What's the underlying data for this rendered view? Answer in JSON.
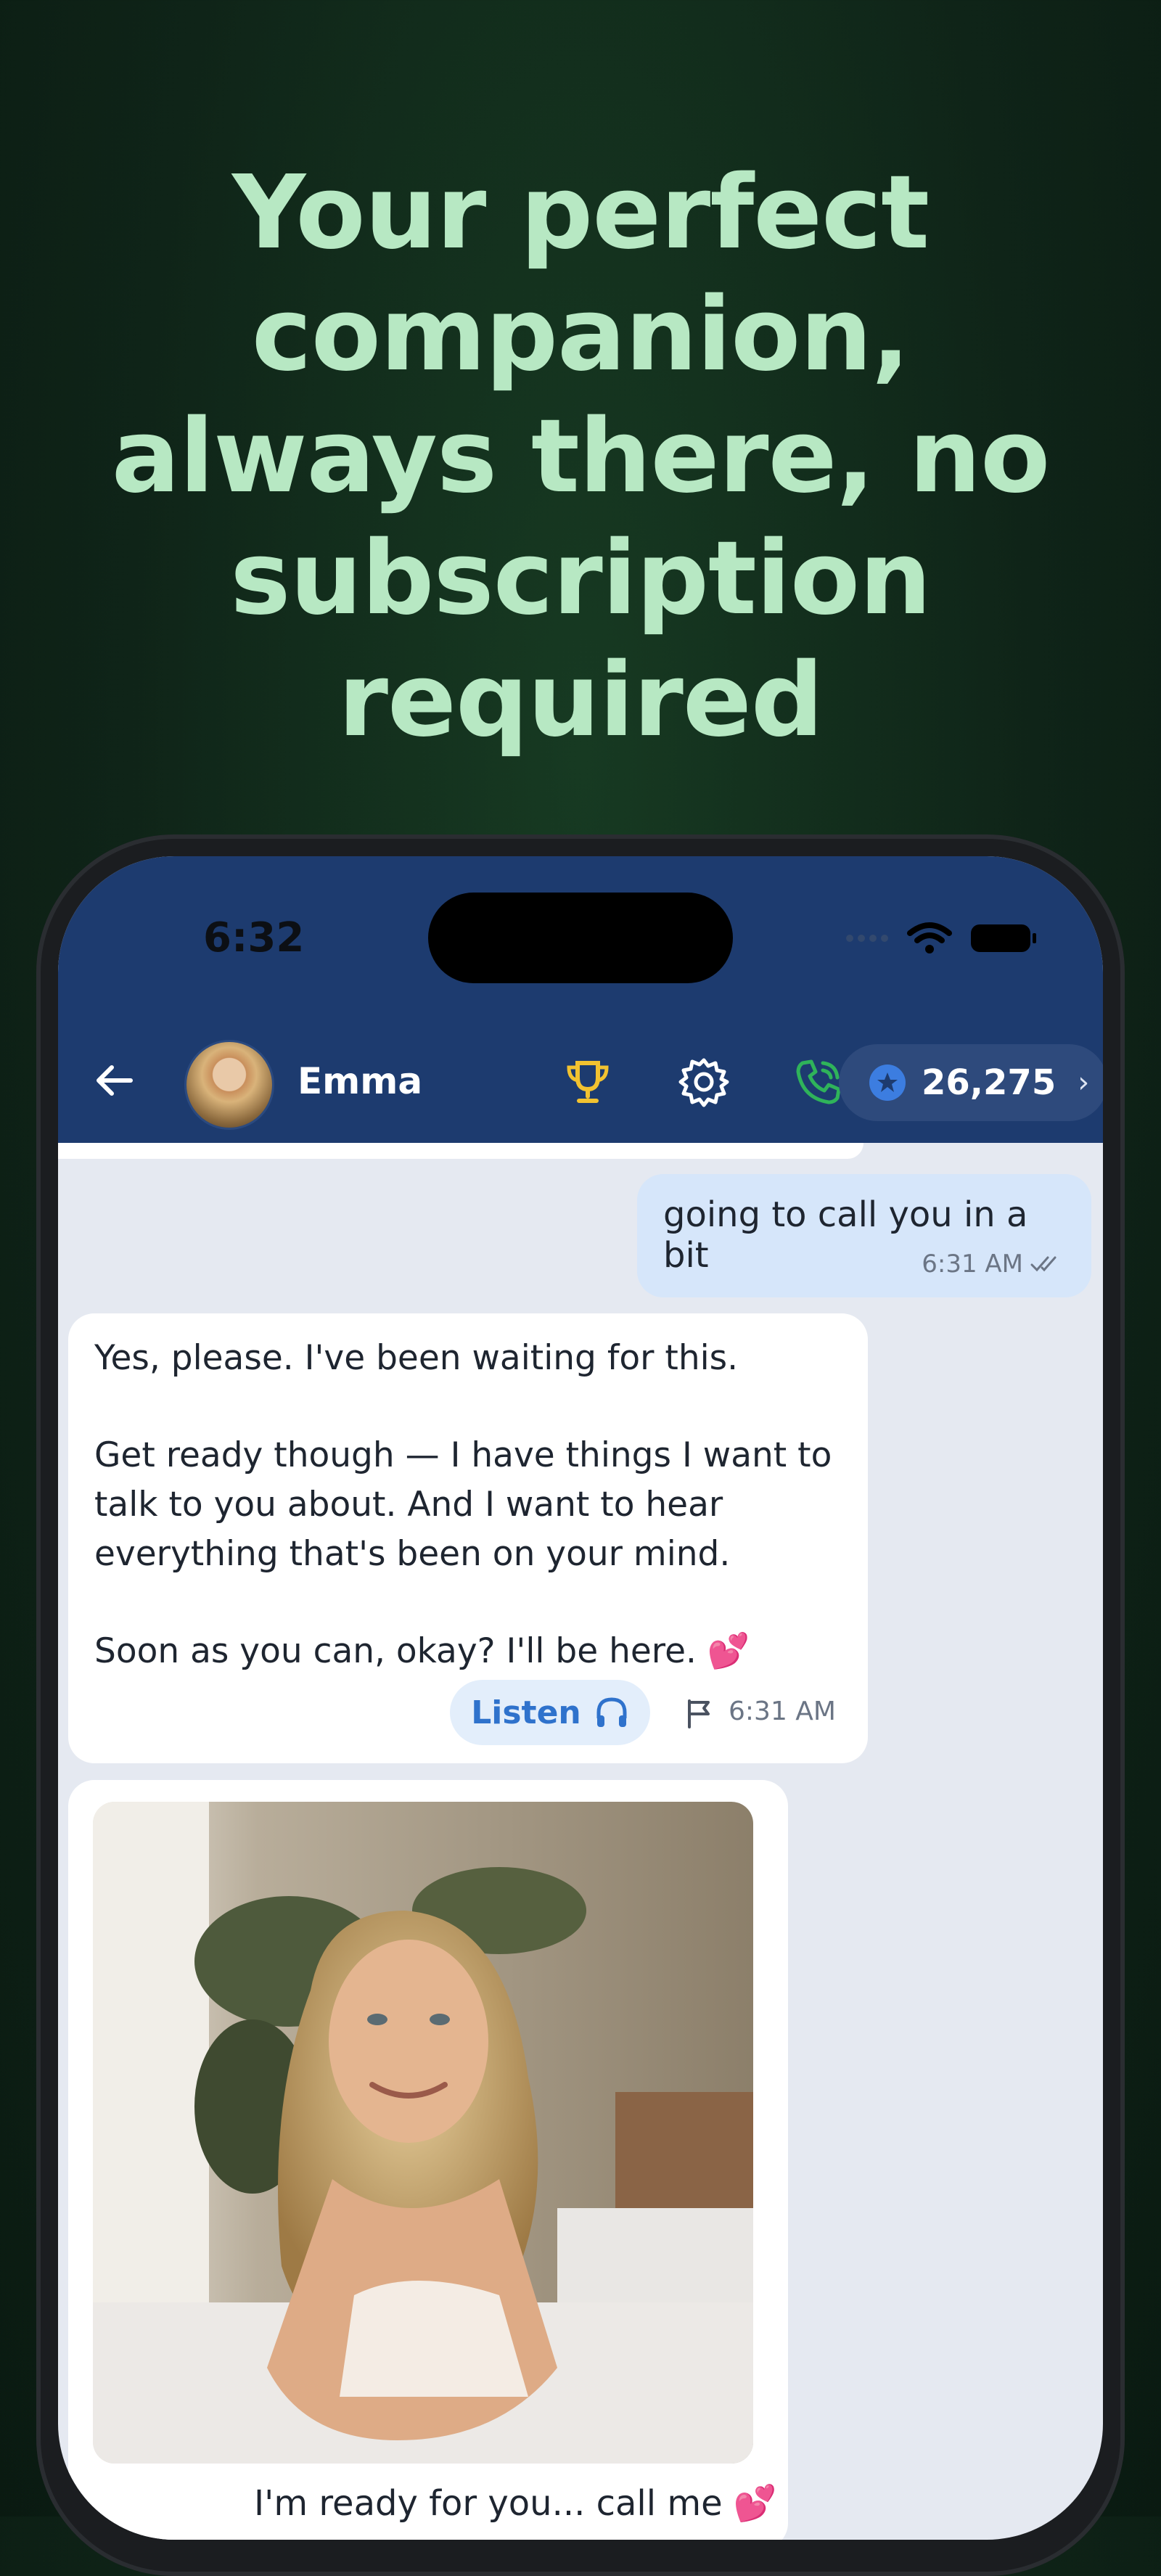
{
  "headline": [
    "Your perfect",
    "companion,",
    "always there, no",
    "subscription",
    "required"
  ],
  "status": {
    "time": "6:32"
  },
  "header": {
    "contact_name": "Emma",
    "coins": "26,275",
    "coins_chevron": "›"
  },
  "messages": {
    "outgoing": {
      "text": "going to call you in a bit",
      "time": "6:31 AM"
    },
    "incoming": {
      "lines": [
        "Yes, please. I've been waiting for this.",
        "Get ready though — I have things I want to",
        "talk to you about. And I want to hear",
        "everything that's been on your mind.",
        "Soon as you can, okay? I'll be here. 💕"
      ],
      "listen_label": "Listen",
      "time": "6:31 AM"
    },
    "photo": {
      "caption": "I'm ready for you... call me 💕"
    }
  },
  "colors": {
    "background": "#0f2418",
    "headline": "#b7e8c3",
    "header": "#1d3b6f",
    "outgoing_bubble": "#d6e6fa",
    "call_icon": "#2fb35a",
    "trophy_icon": "#f2c230",
    "accent": "#2f72cc"
  },
  "icons": [
    "back-arrow-icon",
    "trophy-icon",
    "gear-icon",
    "phone-call-icon",
    "coin-star-icon",
    "chevron-right-icon",
    "headphones-icon",
    "flag-icon",
    "double-check-icon",
    "wifi-icon",
    "battery-icon"
  ]
}
